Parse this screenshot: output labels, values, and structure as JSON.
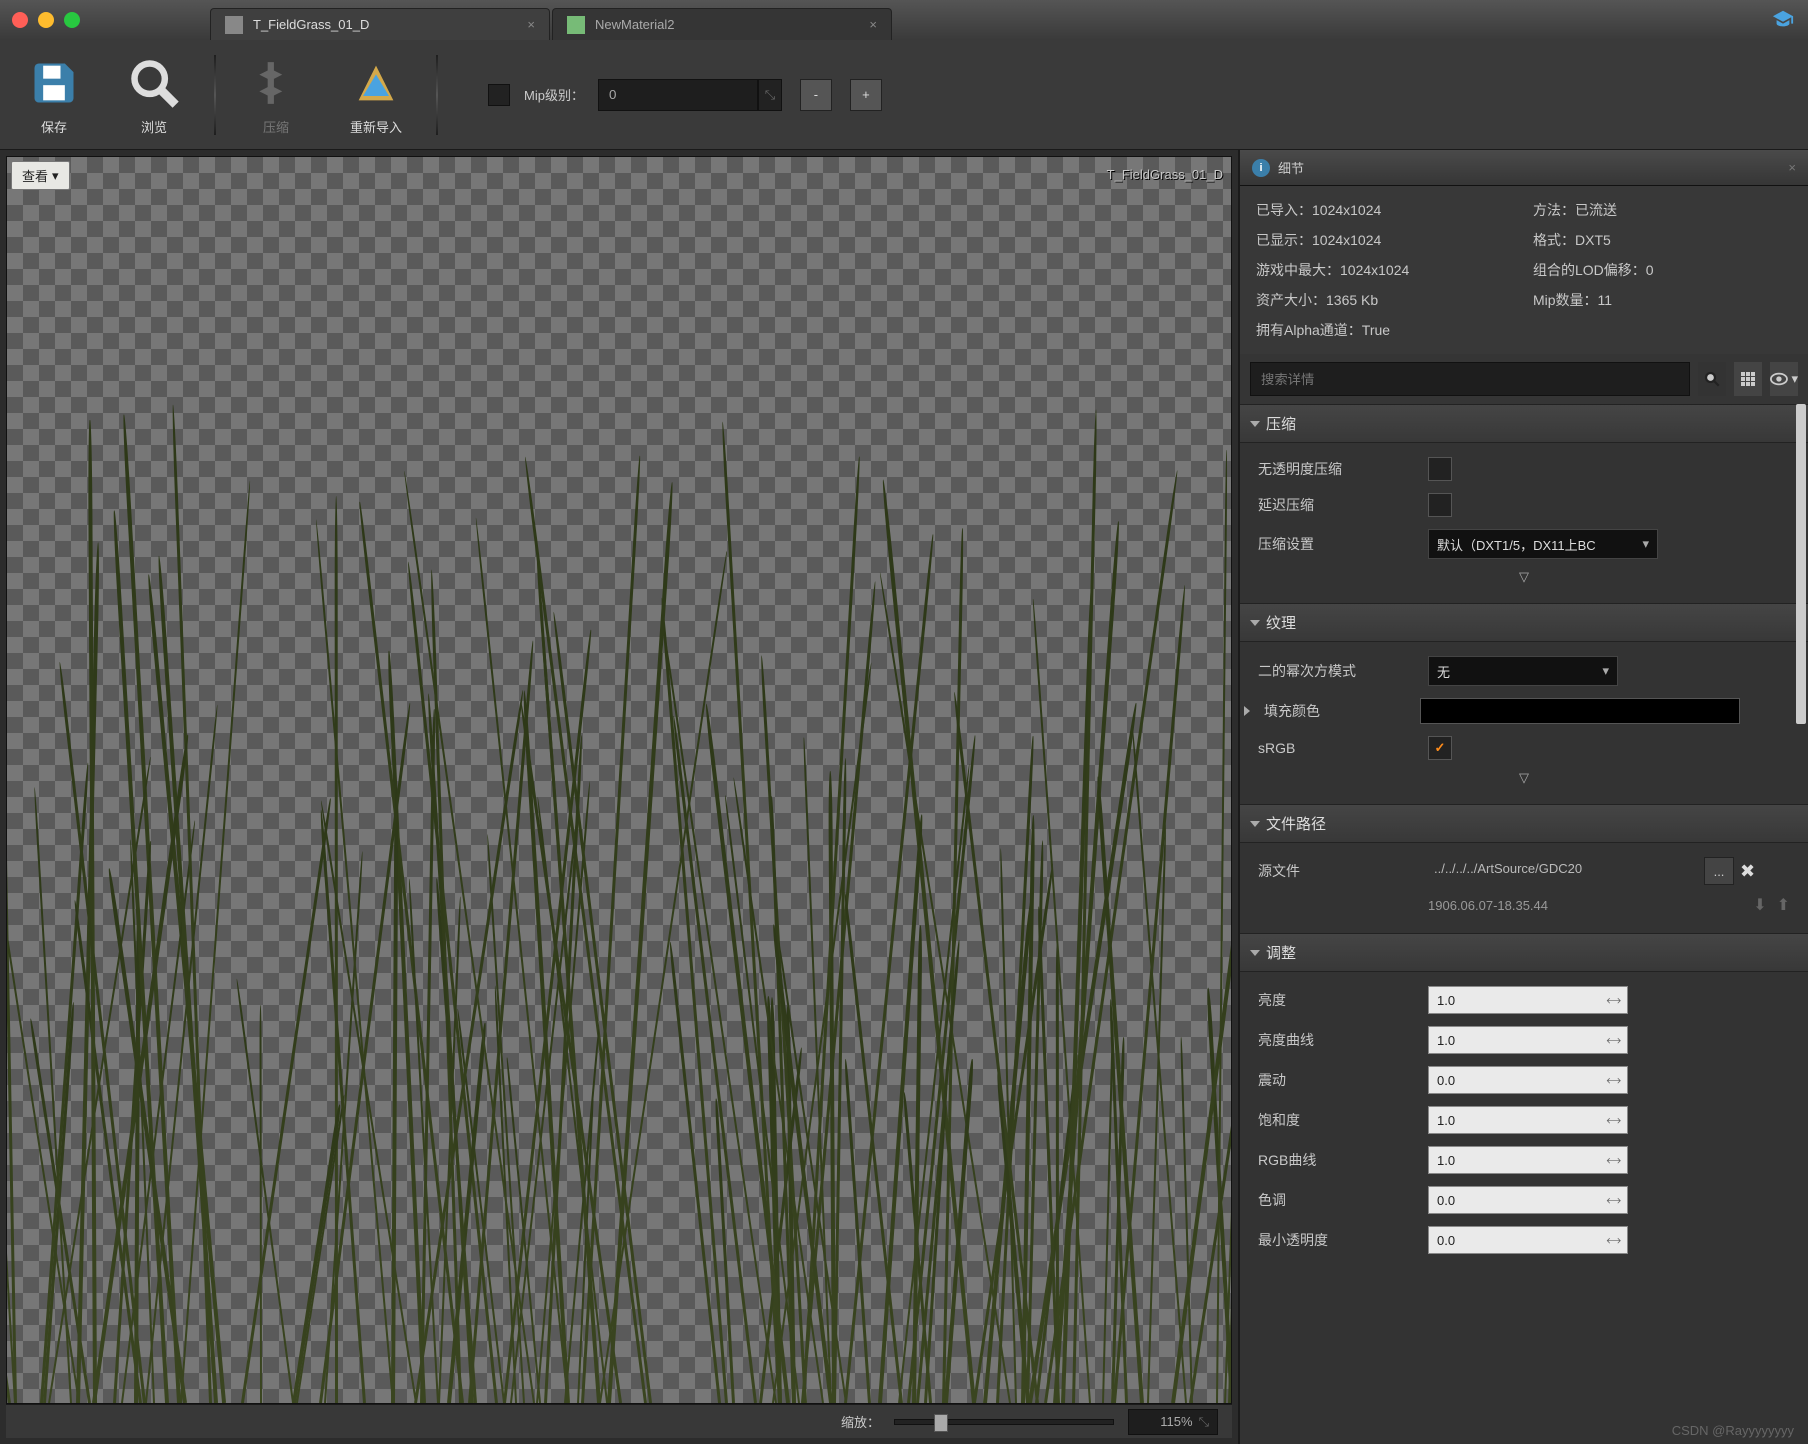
{
  "tabs": [
    {
      "label": "T_FieldGrass_01_D",
      "active": true
    },
    {
      "label": "NewMaterial2",
      "active": false
    }
  ],
  "toolbar": {
    "save": "保存",
    "browse": "浏览",
    "compress": "压缩",
    "reimport": "重新导入",
    "mip_label": "Mip级别：",
    "mip_value": "0",
    "minus": "-",
    "plus": "+"
  },
  "viewport": {
    "view_btn": "查看",
    "asset_name": "T_FieldGrass_01_D",
    "zoom_label": "缩放：",
    "zoom_value": "115%"
  },
  "panel_title": "细节",
  "info": {
    "imported": "已导入：1024x1024",
    "method": "方法：已流送",
    "displayed": "已显示：1024x1024",
    "format": "格式：DXT5",
    "max_ingame": "游戏中最大：1024x1024",
    "lod_bias": "组合的LOD偏移：0",
    "asset_size": "资产大小：1365 Kb",
    "mip_count": "Mip数量：11",
    "has_alpha": "拥有Alpha通道：True"
  },
  "search_placeholder": "搜索详情",
  "sections": {
    "compress": {
      "title": "压缩",
      "no_alpha": "无透明度压缩",
      "defer": "延迟压缩",
      "setting": "压缩设置",
      "setting_value": "默认（DXT1/5，DX11上BC"
    },
    "texture": {
      "title": "纹理",
      "pow2": "二的幂次方模式",
      "pow2_value": "无",
      "fill": "填充颜色",
      "srgb": "sRGB"
    },
    "filepath": {
      "title": "文件路径",
      "source": "源文件",
      "source_value": "../../../../ArtSource/GDC20",
      "timestamp": "1906.06.07-18.35.44"
    },
    "adjust": {
      "title": "调整",
      "rows": [
        {
          "label": "亮度",
          "value": "1.0"
        },
        {
          "label": "亮度曲线",
          "value": "1.0"
        },
        {
          "label": "震动",
          "value": "0.0"
        },
        {
          "label": "饱和度",
          "value": "1.0"
        },
        {
          "label": "RGB曲线",
          "value": "1.0"
        },
        {
          "label": "色调",
          "value": "0.0"
        },
        {
          "label": "最小透明度",
          "value": "0.0"
        }
      ]
    }
  },
  "watermark": "CSDN @Rayyyyyyyy"
}
